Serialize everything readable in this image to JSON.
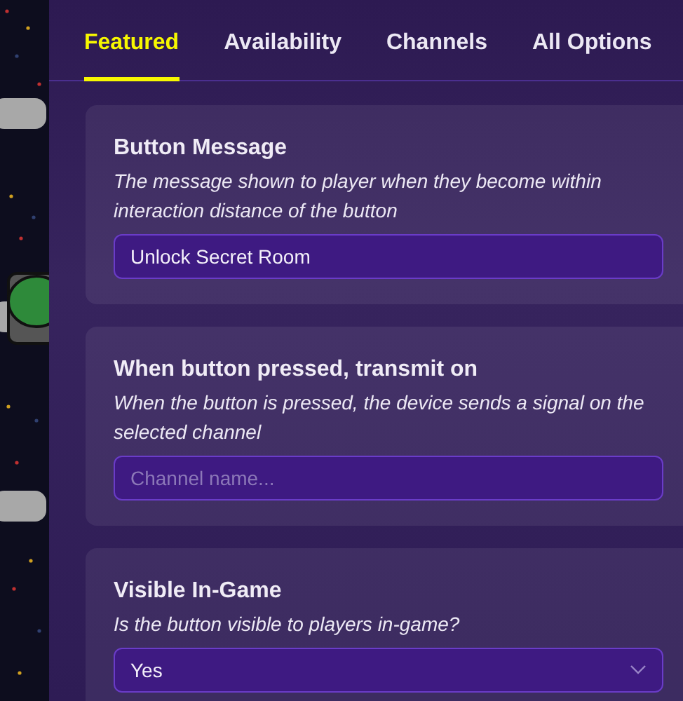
{
  "tabs": [
    {
      "label": "Featured",
      "selected": true
    },
    {
      "label": "Availability",
      "selected": false
    },
    {
      "label": "Channels",
      "selected": false
    },
    {
      "label": "All Options",
      "selected": false
    }
  ],
  "sections": [
    {
      "title": "Button Message",
      "description": "The message shown to player when they become within interaction distance of the button",
      "field": {
        "kind": "text",
        "value": "Unlock Secret Room"
      }
    },
    {
      "title": "When button pressed, transmit on",
      "description": "When the button is pressed, the device sends a signal on the selected channel",
      "field": {
        "kind": "text",
        "placeholder": "Channel name..."
      }
    },
    {
      "title": "Visible In-Game",
      "description": "Is the button visible to players in-game?",
      "field": {
        "kind": "select",
        "value": "Yes"
      }
    }
  ]
}
